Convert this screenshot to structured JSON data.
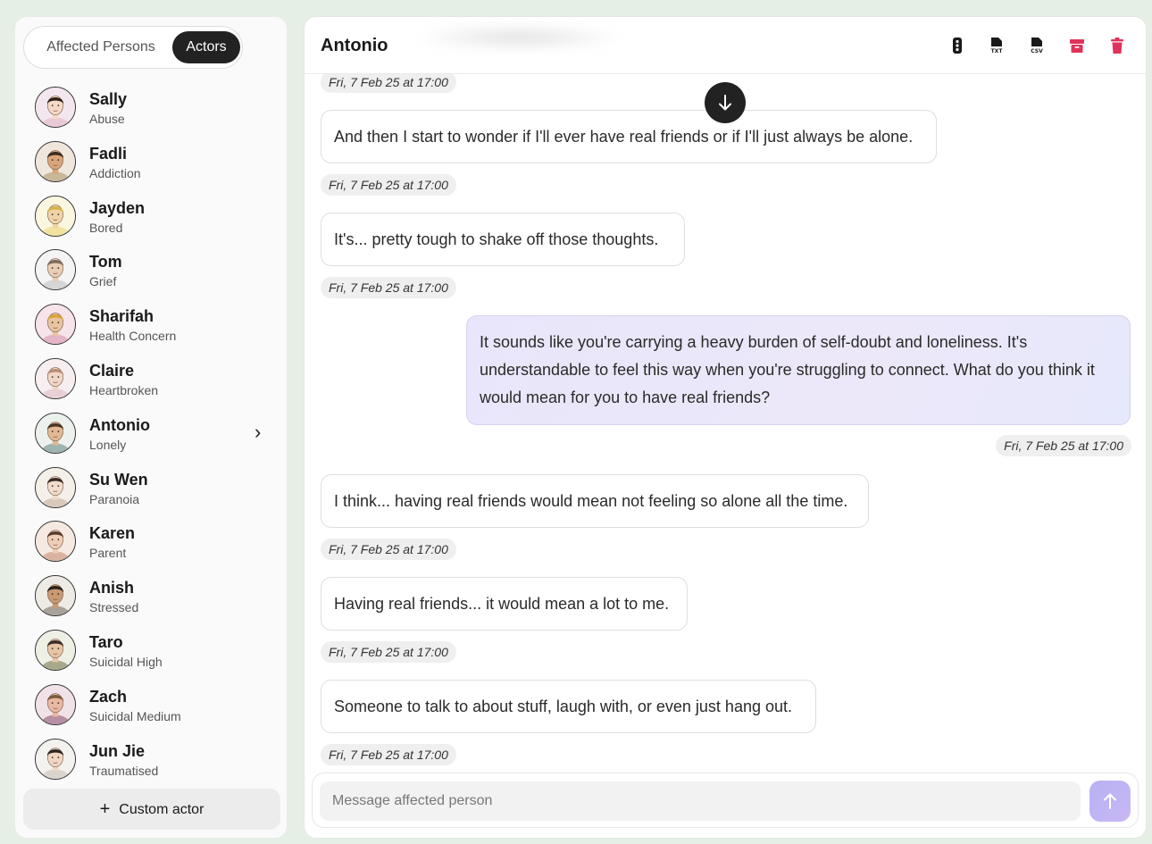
{
  "sidebar": {
    "tabs": [
      {
        "label": "Affected Persons",
        "active": false
      },
      {
        "label": "Actors",
        "active": true
      }
    ],
    "actors": [
      {
        "name": "Sally",
        "tag": "Abuse",
        "skin": "#f4d9c6",
        "hair": "#2b2118",
        "shirt": "#e9c8d8",
        "bg": "#f3e6ee"
      },
      {
        "name": "Fadli",
        "tag": "Addiction",
        "skin": "#d9a57b",
        "hair": "#3b2a1e",
        "shirt": "#c9b79a",
        "bg": "#efe7dc"
      },
      {
        "name": "Jayden",
        "tag": "Bored",
        "skin": "#f0d4a8",
        "hair": "#d8b24a",
        "shirt": "#f2e3a0",
        "bg": "#fbf6df"
      },
      {
        "name": "Tom",
        "tag": "Grief",
        "skin": "#e9cdb6",
        "hair": "#7a6a5a",
        "shirt": "#d6d6d6",
        "bg": "#f4f4f4"
      },
      {
        "name": "Sharifah",
        "tag": "Health Concern",
        "skin": "#e8c4a2",
        "hair": "#d9a33a",
        "shirt": "#e4b4c8",
        "bg": "#f6e4ea"
      },
      {
        "name": "Claire",
        "tag": "Heartbroken",
        "skin": "#f1d6c6",
        "hair": "#b98c78",
        "shirt": "#e8cfd6",
        "bg": "#f7eef0"
      },
      {
        "name": "Antonio",
        "tag": "Lonely",
        "skin": "#e2b894",
        "hair": "#4a3526",
        "shirt": "#9fb4b0",
        "bg": "#edf1ee",
        "selected": true
      },
      {
        "name": "Su Wen",
        "tag": "Paranoia",
        "skin": "#f1dccb",
        "hair": "#3a2c24",
        "shirt": "#d8c9bb",
        "bg": "#f5efe9"
      },
      {
        "name": "Karen",
        "tag": "Parent",
        "skin": "#f0cdb8",
        "hair": "#5a3a28",
        "shirt": "#d9b2a2",
        "bg": "#f6e9e2"
      },
      {
        "name": "Anish",
        "tag": "Stressed",
        "skin": "#c99a72",
        "hair": "#2a221d",
        "shirt": "#a9a29a",
        "bg": "#eeebe7"
      },
      {
        "name": "Taro",
        "tag": "Suicidal High",
        "skin": "#e6c4a4",
        "hair": "#3a2e25",
        "shirt": "#a7a98a",
        "bg": "#eef0e6"
      },
      {
        "name": "Zach",
        "tag": "Suicidal Medium",
        "skin": "#e9b7a2",
        "hair": "#7a5a3a",
        "shirt": "#b78fa4",
        "bg": "#f1e2e8"
      },
      {
        "name": "Jun Jie",
        "tag": "Traumatised",
        "skin": "#f0d6c2",
        "hair": "#2c2520",
        "shirt": "#d9d4cc",
        "bg": "#f4f2ef"
      }
    ],
    "custom_actor_label": "Custom actor"
  },
  "chat": {
    "title": "Antonio",
    "header_icons": [
      "traffic-light-icon",
      "download-txt-icon",
      "download-csv-icon",
      "archive-icon",
      "trash-icon"
    ],
    "icon_labels": {
      "txt": "TXT",
      "csv": "CSV"
    },
    "danger_color": "#e0335a",
    "messages": [
      {
        "role": "ts",
        "text": "Fri, 7 Feb 25 at 17:00"
      },
      {
        "role": "actor",
        "text": "And then I start to wonder if I'll ever have real friends or if I'll just always be alone."
      },
      {
        "role": "ts",
        "text": "Fri, 7 Feb 25 at 17:00"
      },
      {
        "role": "actor",
        "text": "It's... pretty tough to shake off those thoughts."
      },
      {
        "role": "ts",
        "text": "Fri, 7 Feb 25 at 17:00"
      },
      {
        "role": "user",
        "lines": [
          "It sounds like you're carrying a heavy burden of self-doubt and loneliness. It's",
          "understandable to feel this way when you're struggling to connect. What do you think it",
          "would mean for you to have real friends?"
        ]
      },
      {
        "role": "ts",
        "text": "Fri, 7 Feb 25 at 17:00"
      },
      {
        "role": "actor",
        "text": "I think... having real friends would mean not feeling so alone all the time."
      },
      {
        "role": "ts",
        "text": "Fri, 7 Feb 25 at 17:00"
      },
      {
        "role": "actor",
        "text": "Having real friends... it would mean a lot to me."
      },
      {
        "role": "ts",
        "text": "Fri, 7 Feb 25 at 17:00"
      },
      {
        "role": "actor",
        "text": "Someone to talk to about stuff, laugh with, or even just hang out."
      },
      {
        "role": "ts",
        "text": "Fri, 7 Feb 25 at 17:00"
      }
    ],
    "input_placeholder": "Message affected person",
    "input_value": ""
  }
}
